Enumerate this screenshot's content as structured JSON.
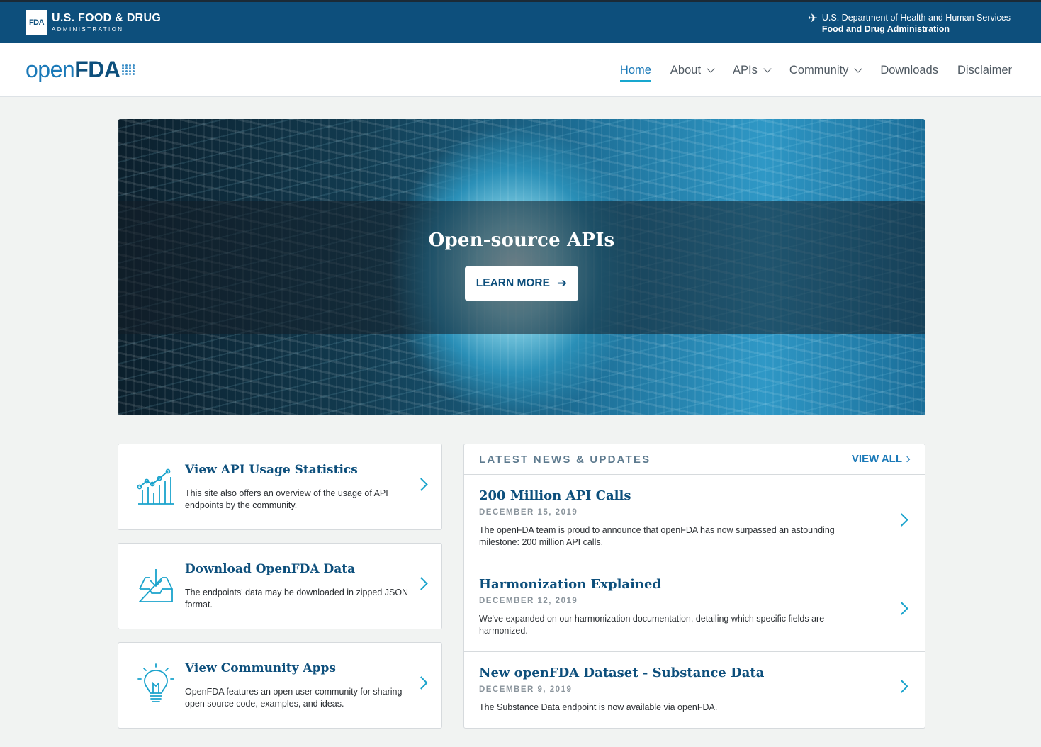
{
  "gov_banner": {
    "agency_abbr": "FDA",
    "agency_line1": "U.S. FOOD & DRUG",
    "agency_line2": "ADMINISTRATION",
    "dept_line1": "U.S. Department of Health and Human Services",
    "dept_line2": "Food and Drug Administration",
    "eagle_icon": "hhs-eagle-icon",
    "bg_color": "#0d4f7c"
  },
  "site": {
    "logo_open": "open",
    "logo_fda": "FDA"
  },
  "nav": {
    "items": [
      {
        "label": "Home",
        "active": true
      },
      {
        "label": "About",
        "dropdown": true
      },
      {
        "label": "APIs",
        "dropdown": true
      },
      {
        "label": "Community",
        "dropdown": true
      },
      {
        "label": "Downloads"
      },
      {
        "label": "Disclaimer"
      }
    ],
    "accent": "#18a7cf"
  },
  "hero": {
    "title": "Open-source APIs",
    "button_label": "LEARN MORE",
    "button_icon": "arrow-right-icon"
  },
  "cards": [
    {
      "title": "View API Usage Statistics",
      "desc": "This site also offers an overview of the usage of API endpoints by the community.",
      "icon": "line-chart-icon"
    },
    {
      "title": "Download OpenFDA Data",
      "desc": "The endpoints' data may be downloaded in zipped JSON format.",
      "icon": "download-tray-icon"
    },
    {
      "title": "View Community Apps",
      "desc": "OpenFDA features an open user community for sharing open source code, examples, and ideas.",
      "icon": "lightbulb-icon"
    }
  ],
  "news": {
    "heading": "LATEST NEWS & UPDATES",
    "view_all": "VIEW ALL",
    "items": [
      {
        "title": "200 Million API Calls",
        "date": "DECEMBER 15, 2019",
        "summary": "The openFDA team is proud to announce that openFDA has now surpassed an astounding milestone: 200 million API calls."
      },
      {
        "title": "Harmonization Explained",
        "date": "DECEMBER 12, 2019",
        "summary": "We've expanded on our harmonization documentation, detailing which specific fields are harmonized."
      },
      {
        "title": "New openFDA Dataset - Substance Data",
        "date": "DECEMBER 9, 2019",
        "summary": "The Substance Data endpoint is now available via openFDA."
      }
    ]
  }
}
